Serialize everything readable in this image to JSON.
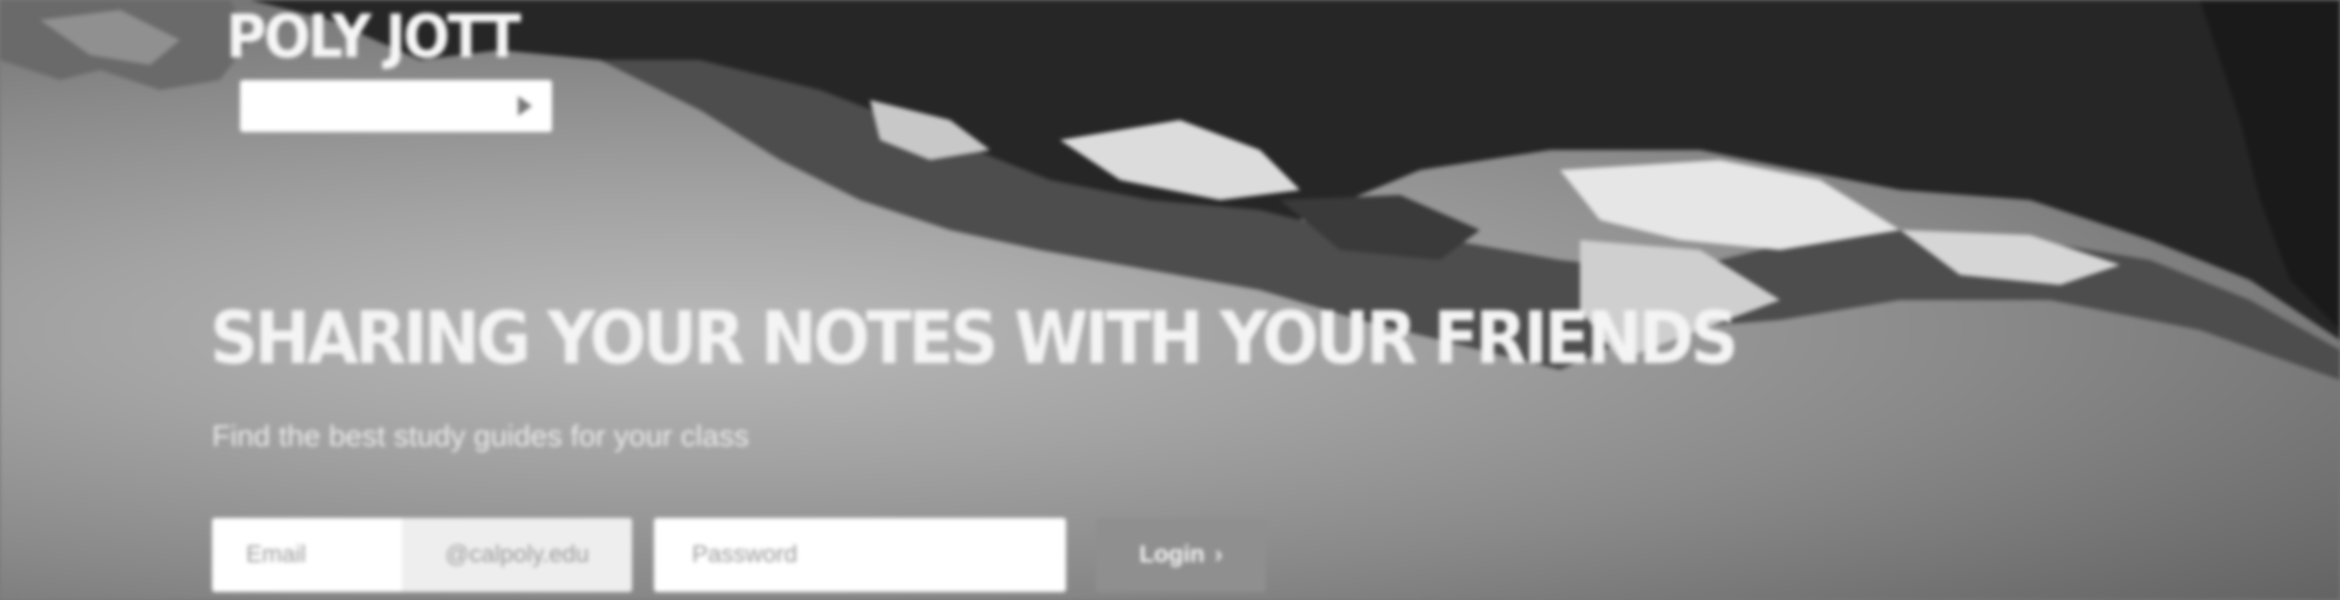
{
  "brand": {
    "logo_text": "POLY JOTT",
    "language_select": {
      "value": "",
      "chevron_icon": "chevron-right-icon"
    }
  },
  "hero": {
    "headline": "SHARING YOUR NOTES WITH YOUR FRIENDS",
    "subheadline": "Find the best study guides for your class"
  },
  "login": {
    "email_placeholder": "Email",
    "email_suffix": "@calpoly.edu",
    "password_placeholder": "Password",
    "login_label": "Login",
    "login_icon": "arrow-right-icon"
  },
  "colors": {
    "background": "#9a9a9a",
    "text": "#f4f4f4",
    "button": "#8f8f8f"
  }
}
